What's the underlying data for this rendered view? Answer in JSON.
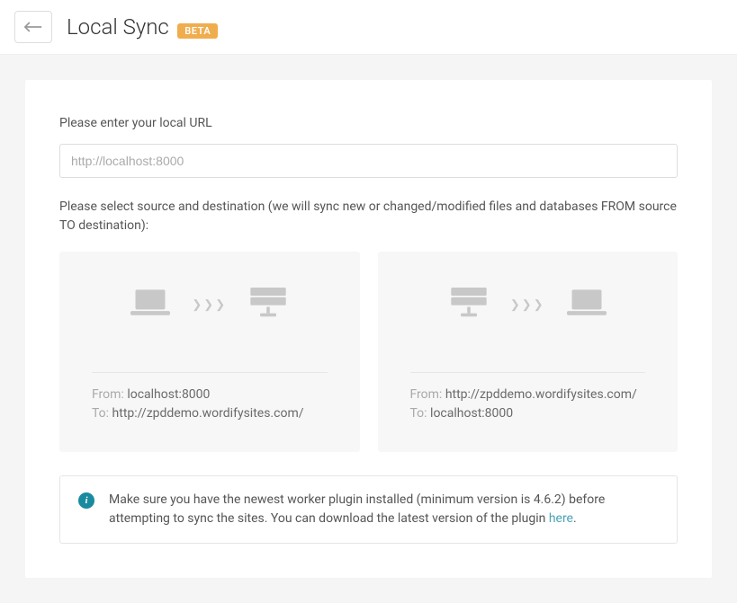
{
  "header": {
    "title": "Local Sync",
    "badge": "BETA"
  },
  "form": {
    "url_label": "Please enter your local URL",
    "url_placeholder": "http://localhost:8000",
    "select_label": "Please select source and destination (we will sync new or changed/modified files and databases FROM source TO destination):"
  },
  "options": [
    {
      "from_label": "From:",
      "from_value": "localhost:8000",
      "to_label": "To:",
      "to_value": "http://zpddemo.wordifysites.com/"
    },
    {
      "from_label": "From:",
      "from_value": "http://zpddemo.wordifysites.com/",
      "to_label": "To:",
      "to_value": "localhost:8000"
    }
  ],
  "info": {
    "text_before": "Make sure you have the newest worker plugin installed (minimum version is 4.6.2) before attempting to sync the sites. You can download the latest version of the plugin ",
    "link_text": "here",
    "text_after": "."
  }
}
